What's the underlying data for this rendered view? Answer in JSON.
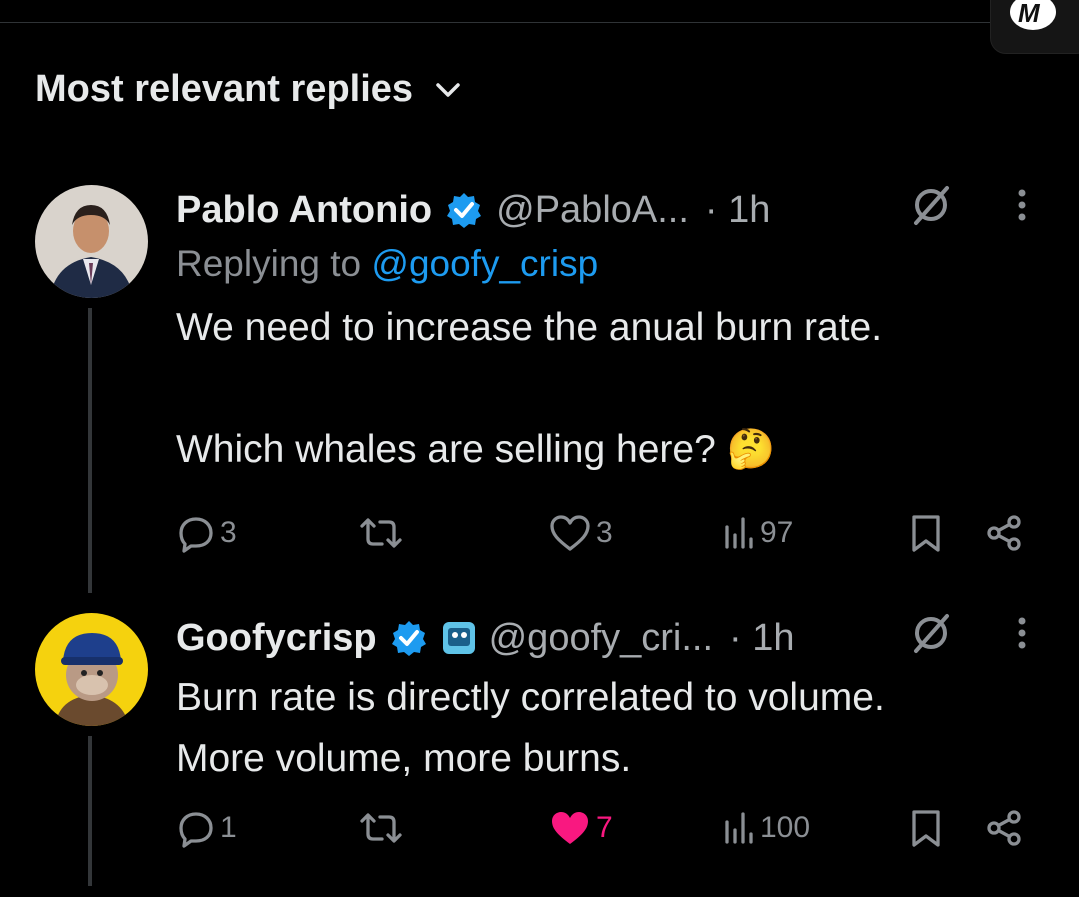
{
  "sort": {
    "label": "Most relevant replies"
  },
  "brand_icon": "coinmarketcap-logo",
  "colors": {
    "verified": "#1d9bf0",
    "mention": "#1d9bf0",
    "liked": "#f91880",
    "muted": "#8b8f94"
  },
  "replies": [
    {
      "name": "Pablo Antonio",
      "handle": "@PabloA...",
      "time": "· 1h",
      "replying_prefix": "Replying to ",
      "replying_to": "@goofy_crisp",
      "text_lines": [
        "We need to increase the anual burn rate.",
        "",
        "Which whales are selling here? 🤔"
      ],
      "replies_count": "3",
      "reposts_count": "",
      "likes_count": "3",
      "views_count": "97",
      "liked": false
    },
    {
      "name": "Goofycrisp",
      "handle": "@goofy_cri...",
      "time": "· 1h",
      "text_lines": [
        "Burn rate is directly correlated to volume.",
        "More volume, more burns."
      ],
      "replies_count": "1",
      "reposts_count": "",
      "likes_count": "7",
      "views_count": "100",
      "liked": true
    }
  ]
}
